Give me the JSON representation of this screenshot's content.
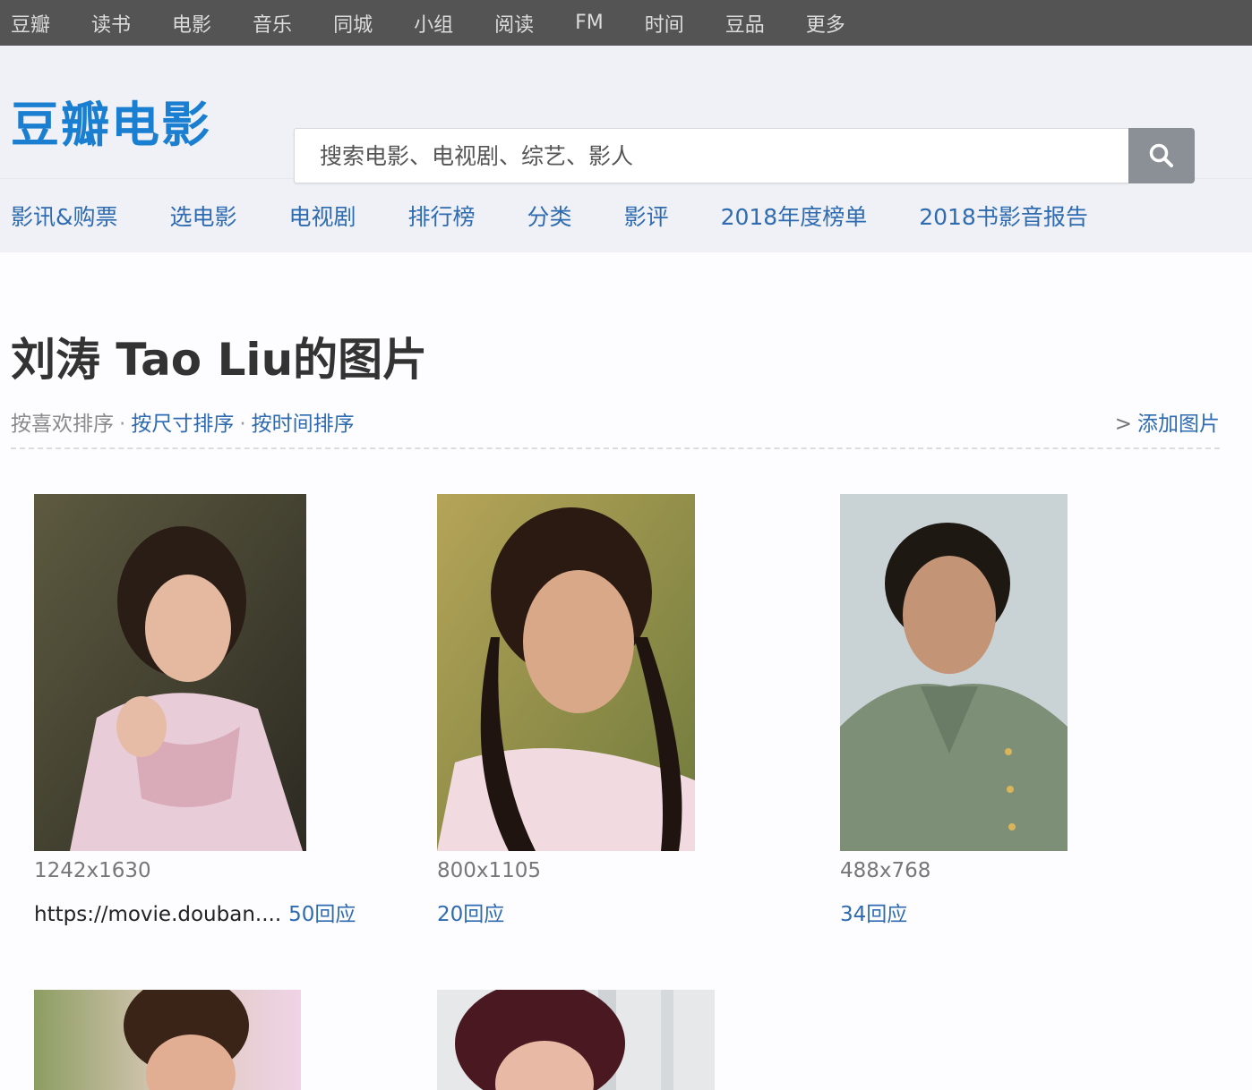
{
  "topnav": [
    "豆瓣",
    "读书",
    "电影",
    "音乐",
    "同城",
    "小组",
    "阅读",
    "FM",
    "时间",
    "豆品",
    "更多"
  ],
  "logo": "豆瓣电影",
  "search": {
    "placeholder": "搜索电影、电视剧、综艺、影人",
    "icon": "search-icon"
  },
  "subnav": [
    "影讯&购票",
    "选电影",
    "电视剧",
    "排行榜",
    "分类",
    "影评",
    "2018年度榜单",
    "2018书影音报告"
  ],
  "page_title": "刘涛 Tao Liu的图片",
  "sort": {
    "current": "按喜欢排序",
    "by_size": "按尺寸排序",
    "by_time": "按时间排序",
    "sep": "·"
  },
  "add_photo": {
    "chevron": ">",
    "label": "添加图片"
  },
  "photos": [
    {
      "size": "1242x1630",
      "desc": "https://movie.douban....",
      "replies": "50回应"
    },
    {
      "size": "800x1105",
      "desc": "",
      "replies": "20回应"
    },
    {
      "size": "488x768",
      "desc": "",
      "replies": "34回应"
    },
    {
      "size": "",
      "desc": "",
      "replies": ""
    },
    {
      "size": "",
      "desc": "",
      "replies": ""
    }
  ],
  "colors": {
    "topnav_bg": "#545454",
    "brand": "#1b7fd1",
    "link": "#2e6bb0",
    "header_bg": "#f0f1f6"
  }
}
